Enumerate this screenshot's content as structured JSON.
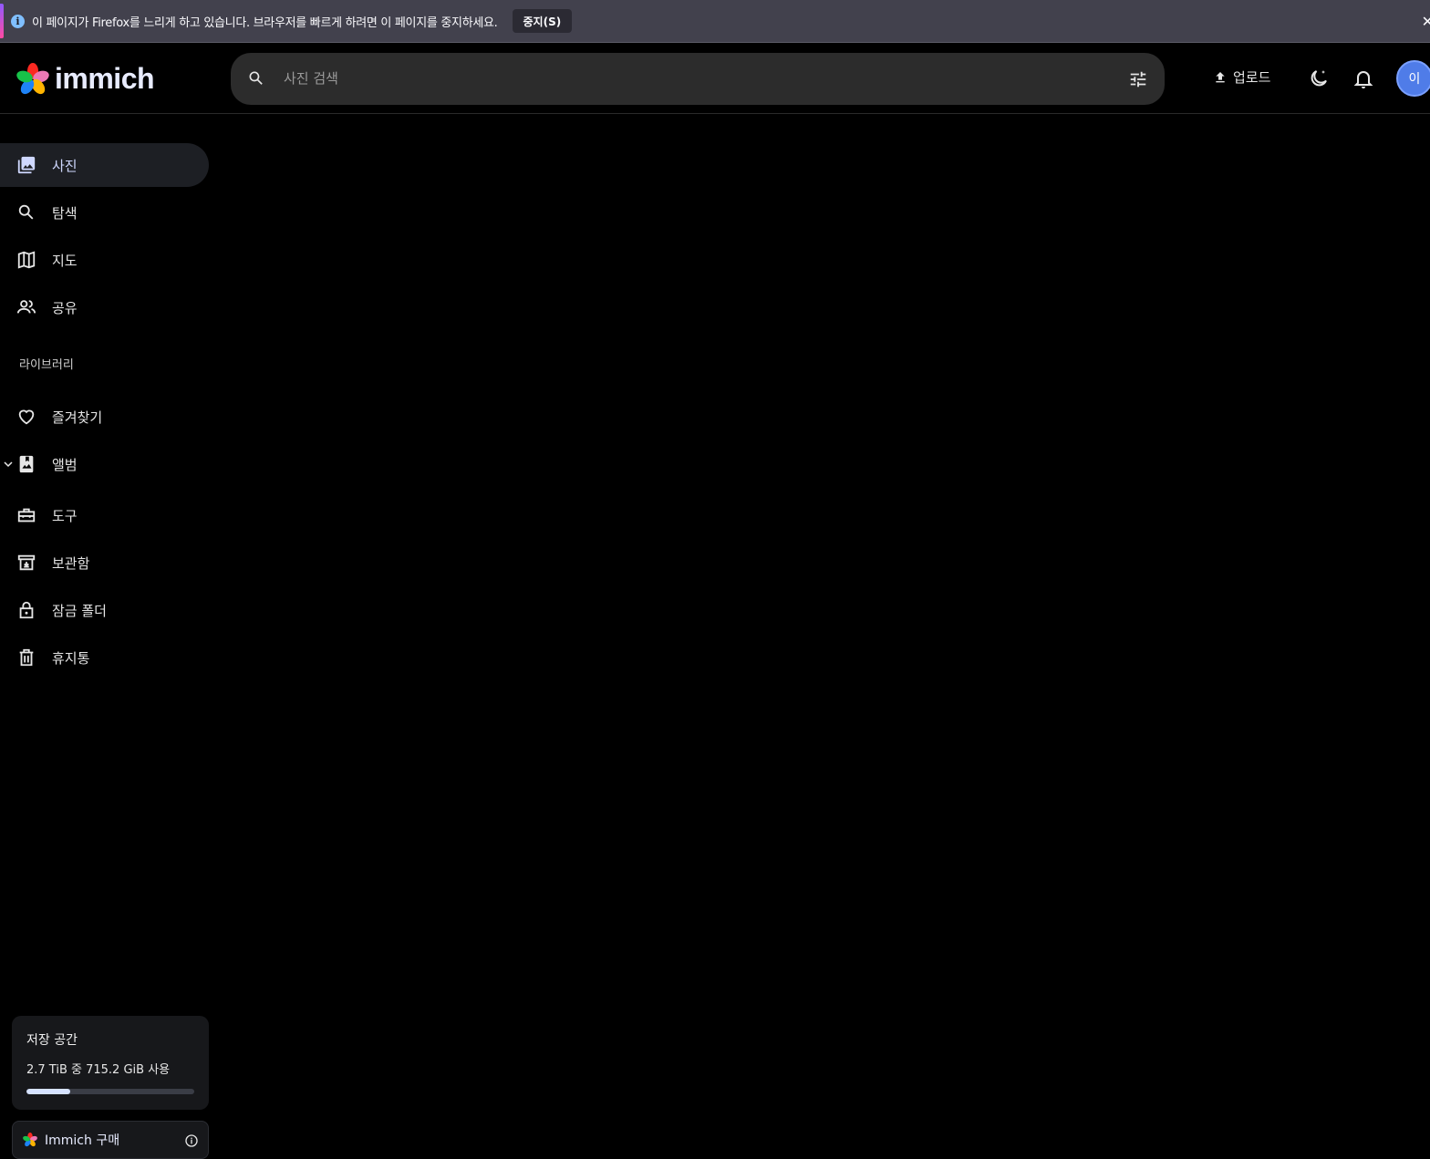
{
  "browser_notification": {
    "message": "이 페이지가 Firefox를 느리게 하고 있습니다. 브라우저를 빠르게 하려면 이 페이지를 중지하세요.",
    "stop_button": "중지(S)",
    "close_icon": "close-icon"
  },
  "header": {
    "brand": "immich",
    "search_placeholder": "사진 검색",
    "upload_label": "업로드",
    "avatar_initial": "이"
  },
  "sidebar": {
    "items": [
      {
        "label": "사진",
        "icon": "photos-icon",
        "active": true
      },
      {
        "label": "탐색",
        "icon": "search-icon"
      },
      {
        "label": "지도",
        "icon": "map-icon"
      },
      {
        "label": "공유",
        "icon": "people-icon"
      }
    ],
    "library_label": "라이브러리",
    "library_items": [
      {
        "label": "즐겨찾기",
        "icon": "heart-icon"
      },
      {
        "label": "앨범",
        "icon": "album-icon"
      },
      {
        "label": "도구",
        "icon": "toolbox-icon"
      },
      {
        "label": "보관함",
        "icon": "archive-icon"
      },
      {
        "label": "잠금 폴더",
        "icon": "lock-icon"
      },
      {
        "label": "휴지통",
        "icon": "trash-icon"
      }
    ],
    "storage": {
      "title": "저장 공간",
      "usage": "2.7 TiB 중 715.2 GiB 사용",
      "used_fraction": 0.26
    },
    "purchase_label": "Immich 구매"
  },
  "colors": {
    "background": "#000000",
    "accent": "#4f7ce8",
    "active_nav": "#1d1f24"
  }
}
